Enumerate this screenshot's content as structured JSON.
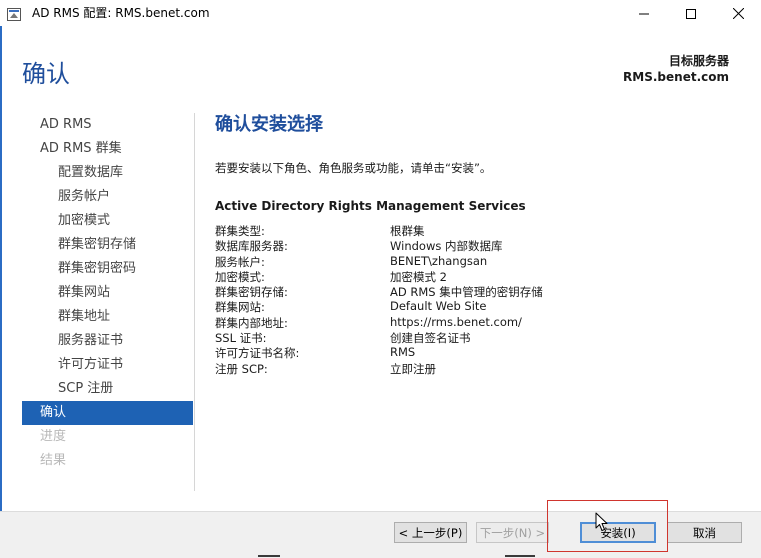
{
  "window": {
    "title": "AD RMS 配置: RMS.benet.com"
  },
  "header": {
    "page_title": "确认",
    "server_label": "目标服务器",
    "server_name": "RMS.benet.com"
  },
  "nav": {
    "items": [
      {
        "label": "AD RMS"
      },
      {
        "label": "AD RMS 群集"
      },
      {
        "label": "配置数据库"
      },
      {
        "label": "服务帐户"
      },
      {
        "label": "加密模式"
      },
      {
        "label": "群集密钥存储"
      },
      {
        "label": "群集密钥密码"
      },
      {
        "label": "群集网站"
      },
      {
        "label": "群集地址"
      },
      {
        "label": "服务器证书"
      },
      {
        "label": "许可方证书"
      },
      {
        "label": "SCP 注册"
      },
      {
        "label": "确认"
      },
      {
        "label": "进度"
      },
      {
        "label": "结果"
      }
    ]
  },
  "content": {
    "section_title": "确认安装选择",
    "intro": "若要安装以下角色、角色服务或功能，请单击“安装”。",
    "role_title": "Active Directory Rights Management Services",
    "details": [
      {
        "key": "群集类型:",
        "value": "根群集"
      },
      {
        "key": "数据库服务器:",
        "value": "Windows 内部数据库"
      },
      {
        "key": "服务帐户:",
        "value": "BENET\\zhangsan"
      },
      {
        "key": "加密模式:",
        "value": "加密模式 2"
      },
      {
        "key": "群集密钥存储:",
        "value": "AD RMS 集中管理的密钥存储"
      },
      {
        "key": "群集网站:",
        "value": "Default Web Site"
      },
      {
        "key": "群集内部地址:",
        "value": "https://rms.benet.com/"
      },
      {
        "key": "SSL 证书:",
        "value": "创建自签名证书"
      },
      {
        "key": "许可方证书名称:",
        "value": "RMS"
      },
      {
        "key": "注册 SCP:",
        "value": "立即注册"
      }
    ]
  },
  "footer": {
    "prev_label": "< 上一步(P)",
    "next_label": "下一步(N) >",
    "install_label": "安装(I)",
    "cancel_label": "取消"
  },
  "colors": {
    "accent": "#1e62b4",
    "heading": "#1f4e9c",
    "highlight": "#d0352e"
  },
  "icons": [
    "app-icon",
    "minimize-icon",
    "maximize-icon",
    "close-icon",
    "mouse-cursor-icon"
  ]
}
